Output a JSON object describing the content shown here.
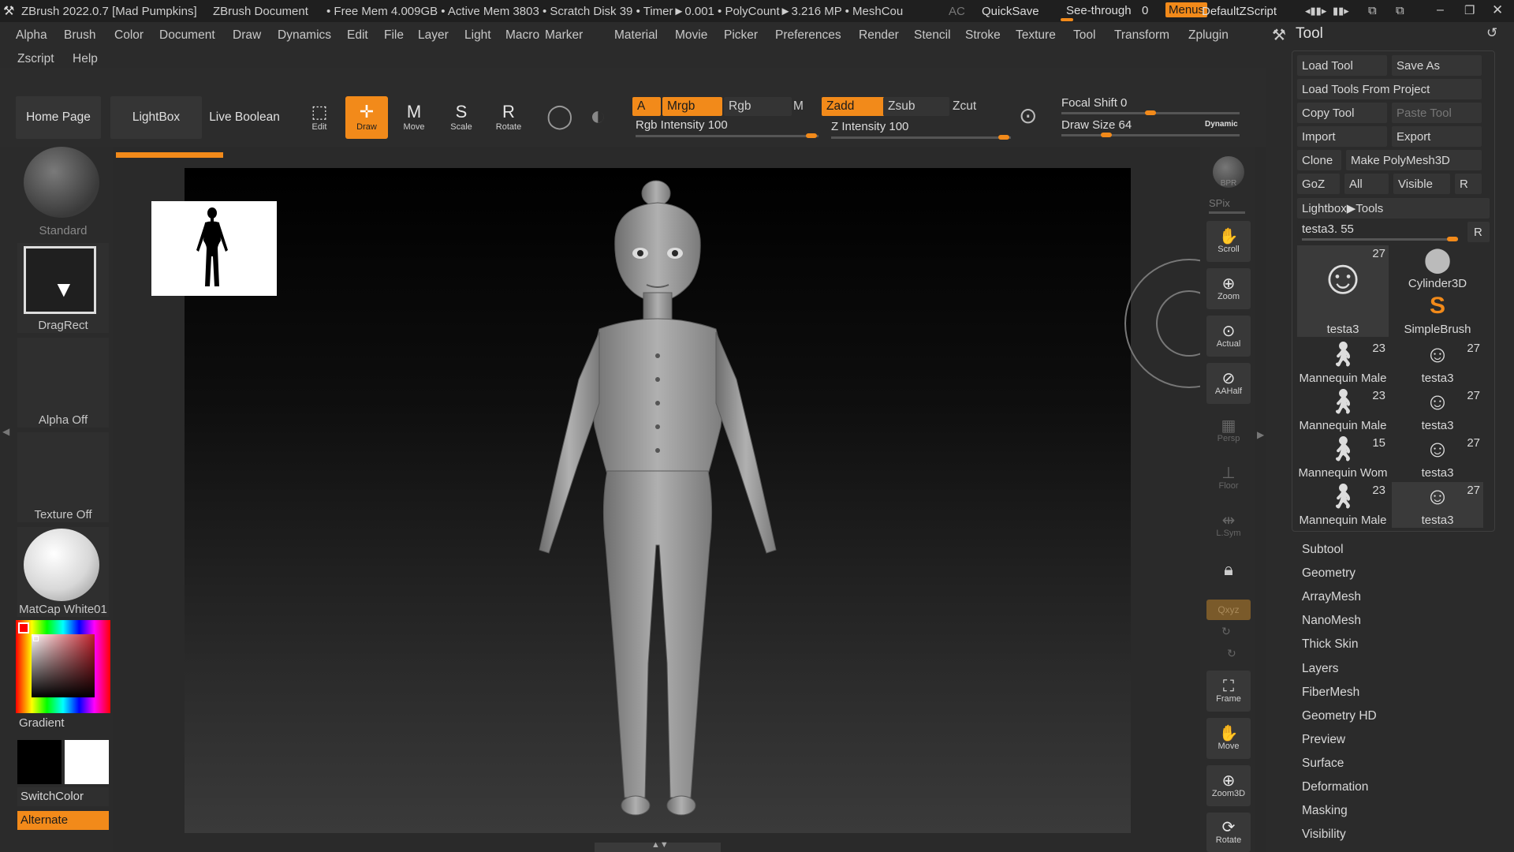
{
  "titlebar": {
    "app": "ZBrush 2022.0.7 [Mad Pumpkins]",
    "document": "ZBrush Document",
    "stats": "• Free Mem 4.009GB • Active Mem 3803 • Scratch Disk 39 • Timer►0.001 • PolyCount►3.216 MP • MeshCou",
    "ac": "AC",
    "quicksave": "QuickSave",
    "see_through_label": "See-through",
    "see_through_value": "0",
    "menus": "Menus",
    "script": "DefaultZScript"
  },
  "menubar": {
    "row1": [
      "Alpha",
      "Brush",
      "Color",
      "Document",
      "Draw",
      "Dynamics",
      "Edit",
      "File",
      "Layer",
      "Light",
      "Macro",
      "Marker",
      "Material",
      "Movie",
      "Picker",
      "Preferences",
      "Render",
      "Stencil",
      "Stroke",
      "Texture",
      "Tool",
      "Transform",
      "Zplugin"
    ],
    "row2": [
      "Zscript",
      "Help"
    ]
  },
  "shelf": {
    "home": "Home Page",
    "lightbox": "LightBox",
    "live_boolean": "Live Boolean",
    "tools": [
      {
        "label": "Edit",
        "icon": "edit-icon",
        "glyph": "⬚",
        "active": false
      },
      {
        "label": "Draw",
        "icon": "draw-icon",
        "glyph": "✛",
        "active": true
      },
      {
        "label": "Move",
        "icon": "move-icon",
        "glyph": "M",
        "active": false
      },
      {
        "label": "Scale",
        "icon": "scale-icon",
        "glyph": "S",
        "active": false
      },
      {
        "label": "Rotate",
        "icon": "rotate-icon",
        "glyph": "R",
        "active": false
      }
    ],
    "a": "A",
    "mrgb": "Mrgb",
    "rgb": "Rgb",
    "m": "M",
    "rgb_intensity": "Rgb Intensity 100",
    "zadd": "Zadd",
    "zsub": "Zsub",
    "zcut": "Zcut",
    "z_intensity": "Z Intensity 100",
    "focal_shift": "Focal Shift 0",
    "draw_size": "Draw Size 64",
    "dynamic": "Dynamic"
  },
  "leftpanel": {
    "brush": "Standard",
    "stroke": "DragRect",
    "alpha": "Alpha Off",
    "texture": "Texture Off",
    "material": "MatCap White01",
    "gradient": "Gradient",
    "switchcolor": "SwitchColor",
    "alternate": "Alternate"
  },
  "rightcol": {
    "bpr": "BPR",
    "spix": "SPix",
    "buttons": [
      {
        "label": "Scroll",
        "icon": "scroll-icon",
        "glyph": "✋",
        "dim": false
      },
      {
        "label": "Zoom",
        "icon": "zoom-icon",
        "glyph": "⊕",
        "dim": false
      },
      {
        "label": "Actual",
        "icon": "actual-icon",
        "glyph": "⊙",
        "dim": false
      },
      {
        "label": "AAHalf",
        "icon": "aahalf-icon",
        "glyph": "⊘",
        "dim": false
      },
      {
        "label": "Persp",
        "icon": "persp-icon",
        "glyph": "▦",
        "dim": true
      },
      {
        "label": "Floor",
        "icon": "floor-icon",
        "glyph": "⊥",
        "dim": true
      },
      {
        "label": "L.Sym",
        "icon": "lsym-icon",
        "glyph": "⇹",
        "dim": true
      }
    ],
    "xyz": "Qxyz",
    "frame": "Frame",
    "move": "Move",
    "zoom3d": "Zoom3D",
    "rotate": "Rotate"
  },
  "toolpanel": {
    "title": "Tool",
    "buttons": [
      [
        "Load Tool",
        "Save As"
      ],
      [
        "Load Tools From Project"
      ],
      [
        "Copy Tool",
        "Paste Tool"
      ],
      [
        "Import",
        "Export"
      ],
      [
        "Clone",
        "Make PolyMesh3D"
      ],
      [
        "GoZ",
        "All",
        "Visible",
        "R"
      ]
    ],
    "lightbox_tools": "Lightbox▶Tools",
    "current_tool": "testa3. 55",
    "r": "R",
    "thumbs": [
      {
        "label": "testa3",
        "count": "27"
      },
      {
        "label": "Cylinder3D",
        "count": ""
      },
      {
        "label": "SimpleBrush",
        "count": ""
      },
      {
        "label": "Mannequin Male",
        "count": "23"
      },
      {
        "label": "testa3",
        "count": "27"
      },
      {
        "label": "Mannequin Male",
        "count": "23"
      },
      {
        "label": "testa3",
        "count": "27"
      },
      {
        "label": "Mannequin Wom",
        "count": "15"
      },
      {
        "label": "testa3",
        "count": "27"
      },
      {
        "label": "Mannequin Male",
        "count": "23"
      },
      {
        "label": "testa3",
        "count": "27"
      }
    ],
    "subpalettes": [
      "Subtool",
      "Geometry",
      "ArrayMesh",
      "NanoMesh",
      "Thick Skin",
      "Layers",
      "FiberMesh",
      "Geometry HD",
      "Preview",
      "Surface",
      "Deformation",
      "Masking",
      "Visibility"
    ]
  },
  "colors": {
    "accent": "#f28a1a",
    "panel": "#2b2b2b"
  }
}
